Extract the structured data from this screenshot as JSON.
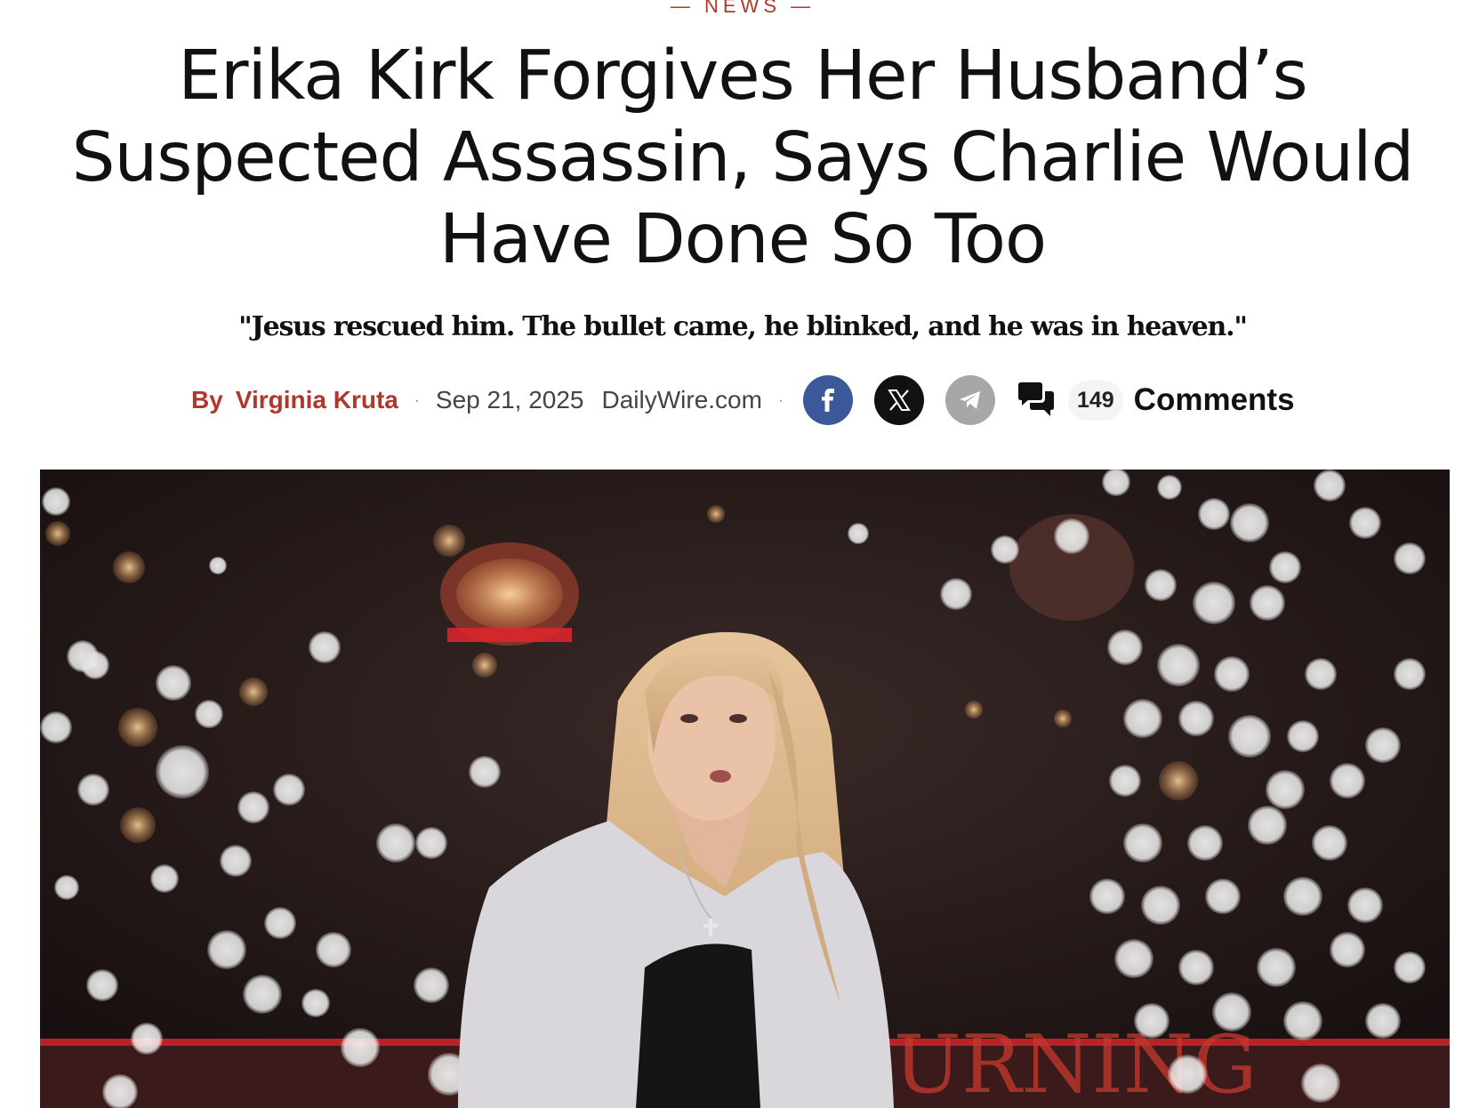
{
  "article": {
    "kicker": "— NEWS —",
    "headline": "Erika Kirk Forgives Her Husband’s Suspected Assassin, Says Charlie Would Have Done So Too",
    "dek": "\"Jesus rescued him. The bullet came, he blinked, and he was in heaven.\""
  },
  "byline": {
    "by_label": "By",
    "author": "Virginia Kruta",
    "date": "Sep 21, 2025",
    "source": "DailyWire.com",
    "separator": "·"
  },
  "share": {
    "facebook_icon": "facebook-icon",
    "x_icon": "x-icon",
    "telegram_icon": "telegram-icon",
    "colors": {
      "facebook": "#3b5998",
      "x": "#111111",
      "telegram": "#a7a7a7"
    }
  },
  "comments": {
    "icon": "comments-icon",
    "count": "149",
    "label": "Comments"
  },
  "hero_image": {
    "overlay_text": "URNING"
  },
  "colors": {
    "accent": "#b1372c",
    "text": "#111111"
  }
}
